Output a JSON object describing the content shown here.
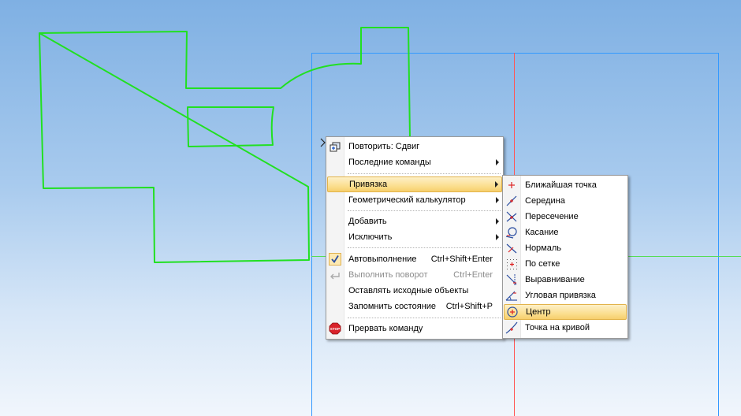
{
  "canvas": {
    "background_top": "#7fb0e3",
    "background_bottom": "#f1f6fc",
    "contour_color": "#21e021",
    "frame_color": "#3399ff",
    "axis_color": "#ff4444"
  },
  "context_menu": {
    "items": [
      {
        "label": "Повторить: Сдвиг",
        "icon": "repeat-icon"
      },
      {
        "label": "Последние команды",
        "submenu": true
      },
      {
        "label": "Привязка",
        "submenu": true,
        "highlighted": true
      },
      {
        "label": "Геометрический калькулятор",
        "submenu": true
      },
      {
        "label": "Добавить",
        "submenu": true
      },
      {
        "label": "Исключить",
        "submenu": true
      },
      {
        "label": "Автовыполнение",
        "shortcut": "Ctrl+Shift+Enter",
        "checked": true
      },
      {
        "label": "Выполнить поворот",
        "shortcut": "Ctrl+Enter",
        "disabled": true
      },
      {
        "label": "Оставлять исходные объекты"
      },
      {
        "label": "Запомнить состояние",
        "shortcut": "Ctrl+Shift+P"
      },
      {
        "label": "Прервать команду",
        "icon": "stop-icon"
      }
    ]
  },
  "snap_submenu": {
    "items": [
      {
        "label": "Ближайшая точка",
        "icon": "nearest-point-icon"
      },
      {
        "label": "Середина",
        "icon": "midpoint-icon"
      },
      {
        "label": "Пересечение",
        "icon": "intersection-icon"
      },
      {
        "label": "Касание",
        "icon": "tangent-icon"
      },
      {
        "label": "Нормаль",
        "icon": "normal-icon"
      },
      {
        "label": "По сетке",
        "icon": "grid-snap-icon"
      },
      {
        "label": "Выравнивание",
        "icon": "alignment-icon"
      },
      {
        "label": "Угловая привязка",
        "icon": "angular-snap-icon"
      },
      {
        "label": "Центр",
        "icon": "center-icon",
        "highlighted": true
      },
      {
        "label": "Точка на кривой",
        "icon": "point-on-curve-icon"
      }
    ]
  }
}
